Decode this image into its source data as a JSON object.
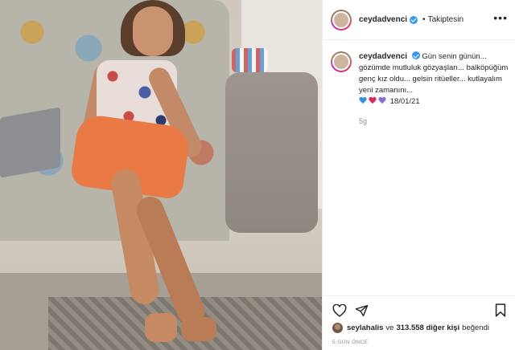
{
  "post": {
    "image_alt": "Girl sitting on a patterned sofa wearing an orange skirt"
  },
  "header": {
    "username": "ceydadvenci",
    "follow_status": "Takiptesin",
    "more_label": "•••"
  },
  "caption": {
    "username": "ceydadvenci",
    "text": "Gün senin günün... gözümde mutluluk gözyaşları... balköpüğüm genç kız oldu... gelsin ritüeller... kutlayalım yeni zamanını...",
    "date": "18/01/21",
    "time_ago": "5g"
  },
  "hearts": [
    "blue",
    "red",
    "purple"
  ],
  "likes": {
    "user": "seylahalis",
    "connector": "ve",
    "count": "313.558 diğer kişi",
    "suffix": "beğendi"
  },
  "posted": "5 GÜN ÖNCE"
}
